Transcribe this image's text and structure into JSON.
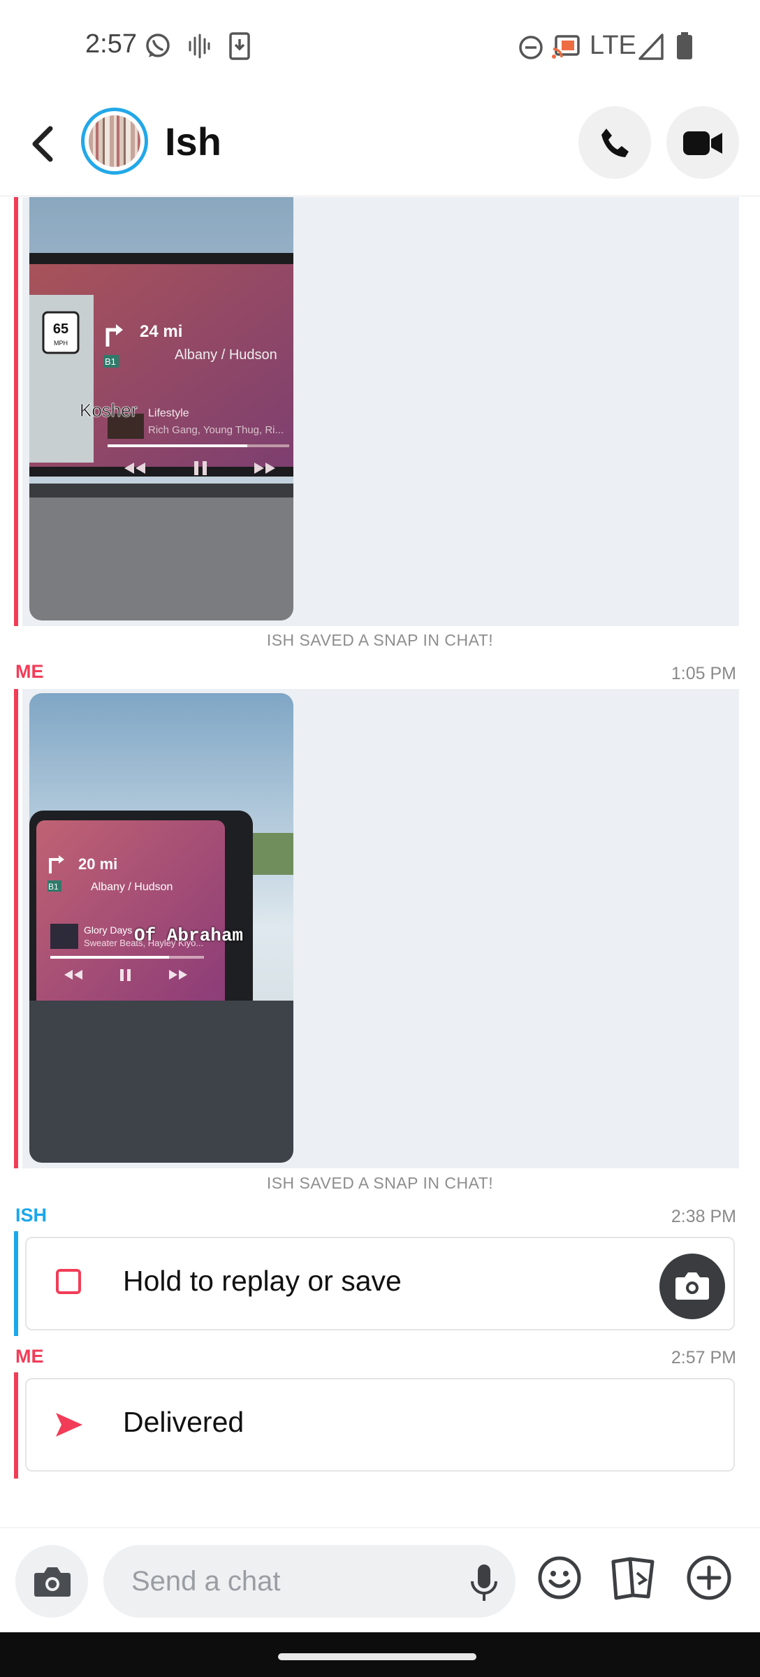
{
  "status_bar": {
    "time": "2:57",
    "network": "LTE",
    "icons": [
      "whatsapp-icon",
      "voicemail-icon",
      "download-icon",
      "do-not-disturb-icon",
      "cast-icon",
      "signal-icon",
      "battery-icon"
    ]
  },
  "header": {
    "contact_name": "Ish",
    "icons": [
      "back-arrow-icon",
      "phone-icon",
      "video-camera-icon"
    ]
  },
  "chat": {
    "snap1": {
      "overlay_caption": "Kosher",
      "saved_note": "ISH SAVED A SNAP IN CHAT!",
      "screen": {
        "speed_sign": "65",
        "speed_unit": "MPH",
        "distance": "24 mi",
        "route": "Albany / Hudson",
        "route_badge": "B1",
        "song": "Lifestyle",
        "artist": "Rich Gang, Young Thug, Ri..."
      }
    },
    "message2": {
      "sender": "ME",
      "time": "1:05 PM",
      "overlay_caption": "Of Abraham",
      "saved_note": "ISH SAVED A SNAP IN CHAT!",
      "screen": {
        "distance": "20 mi",
        "route": "Albany / Hudson",
        "route_badge": "B1",
        "song": "Glory Days",
        "artist": "Sweater Beats, Hayley Kiyo..."
      }
    },
    "message3": {
      "sender": "ISH",
      "time": "2:38 PM",
      "text": "Hold to replay or save"
    },
    "message4": {
      "sender": "ME",
      "time": "2:57 PM",
      "text": "Delivered"
    }
  },
  "input": {
    "placeholder": "Send a chat"
  },
  "colors": {
    "me": "#f23c57",
    "ish": "#1aa7ec",
    "media_panel": "#eceff3"
  }
}
